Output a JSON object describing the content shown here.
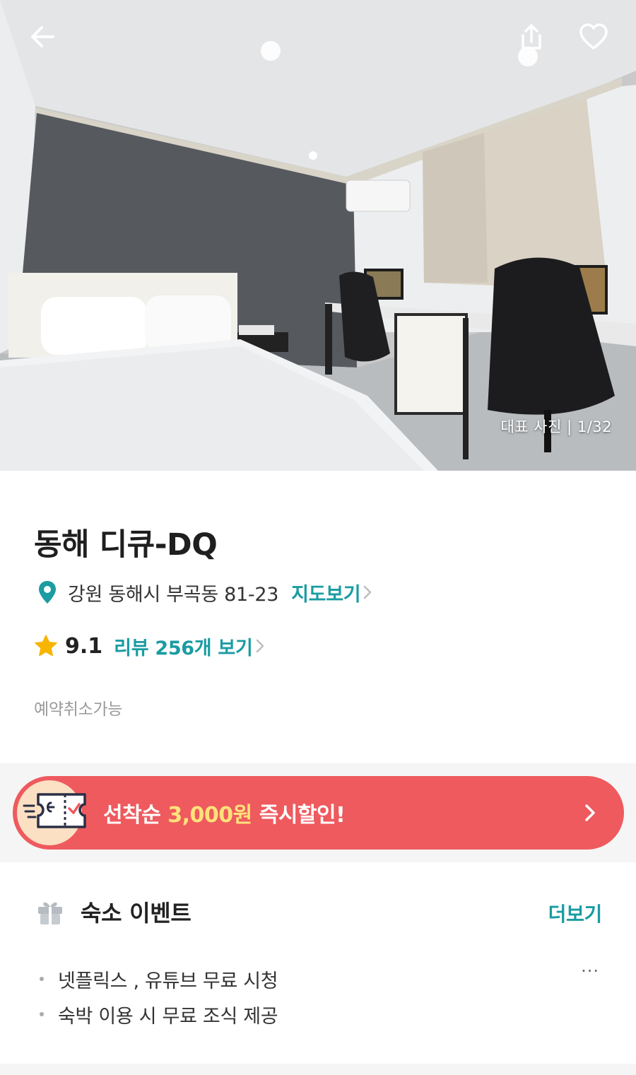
{
  "hero": {
    "photo_counter": "대표 사진 | 1/32",
    "icons": {
      "back": "arrow-left-icon",
      "share": "share-icon",
      "favorite": "heart-outline-icon"
    }
  },
  "info": {
    "title": "동해 디큐-DQ",
    "address": "강원 동해시 부곡동 81-23",
    "map_link": "지도보기",
    "rating": "9.1",
    "review_link": "리뷰 256개 보기",
    "cancel_policy": "예약취소가능"
  },
  "banner": {
    "prefix": "선착순",
    "amount": "3,000원",
    "suffix": "즉시할인!"
  },
  "events": {
    "title": "숙소 이벤트",
    "more_label": "더보기",
    "items": [
      "넷플릭스 , 유튜브 무료 시청",
      "숙박 이용 시 무료 조식 제공"
    ],
    "ellipsis": "···"
  },
  "colors": {
    "accent": "#1a9ca2",
    "banner": "#ee5a5e",
    "banner_amount": "#ffe27a",
    "star": "#f7b500"
  }
}
